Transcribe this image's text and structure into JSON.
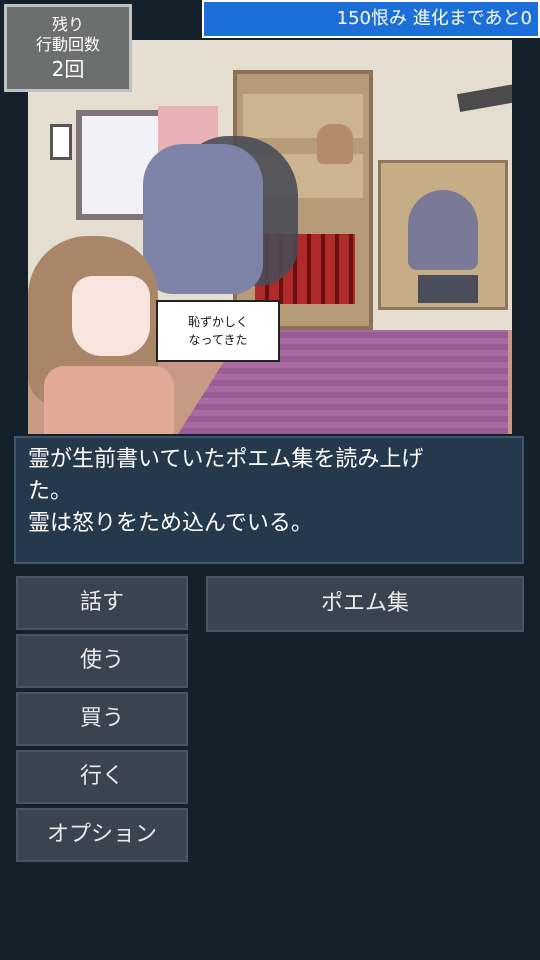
{
  "hud": {
    "actions_label": "残り\n行動回数",
    "actions_count": "2回",
    "status": "150恨み 進化まであと0"
  },
  "scene": {
    "speech": "恥ずかしく\nなってきた"
  },
  "message": {
    "lines": [
      "霊が生前書いていたポエム集を読み上げ",
      "た。",
      "霊は怒りをため込んでいる。"
    ]
  },
  "menu": {
    "items": [
      "話す",
      "使う",
      "買う",
      "行く",
      "オプション"
    ]
  },
  "submenu": {
    "item": "ポエム集"
  }
}
